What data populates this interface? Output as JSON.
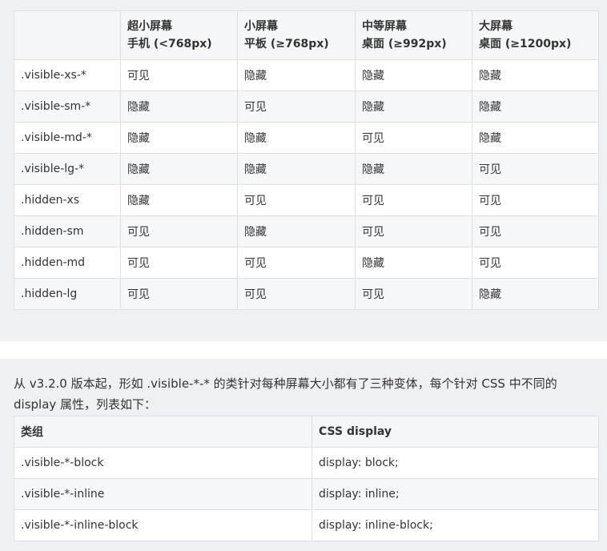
{
  "visibility_table": {
    "headers": [
      {
        "line1": "",
        "line2": ""
      },
      {
        "line1": "超小屏幕",
        "line2": "手机 (<768px)"
      },
      {
        "line1": "小屏幕",
        "line2": "平板 (≥768px)"
      },
      {
        "line1": "中等屏幕",
        "line2": "桌面 (≥992px)"
      },
      {
        "line1": "大屏幕",
        "line2": "桌面 (≥1200px)"
      }
    ],
    "rows": [
      {
        "cls": ".visible-xs-*",
        "cells": [
          "可见",
          "隐藏",
          "隐藏",
          "隐藏"
        ]
      },
      {
        "cls": ".visible-sm-*",
        "cells": [
          "隐藏",
          "可见",
          "隐藏",
          "隐藏"
        ]
      },
      {
        "cls": ".visible-md-*",
        "cells": [
          "隐藏",
          "隐藏",
          "可见",
          "隐藏"
        ]
      },
      {
        "cls": ".visible-lg-*",
        "cells": [
          "隐藏",
          "隐藏",
          "隐藏",
          "可见"
        ]
      },
      {
        "cls": ".hidden-xs",
        "cells": [
          "隐藏",
          "可见",
          "可见",
          "可见"
        ]
      },
      {
        "cls": ".hidden-sm",
        "cells": [
          "可见",
          "隐藏",
          "可见",
          "可见"
        ]
      },
      {
        "cls": ".hidden-md",
        "cells": [
          "可见",
          "可见",
          "隐藏",
          "可见"
        ]
      },
      {
        "cls": ".hidden-lg",
        "cells": [
          "可见",
          "可见",
          "可见",
          "隐藏"
        ]
      }
    ]
  },
  "intro_text": "从 v3.2.0 版本起，形如 .visible-*-* 的类针对每种屏幕大小都有了三种变体，每个针对 CSS 中不同的 display 属性，列表如下：",
  "class_table": {
    "headers": [
      "类组",
      "CSS display"
    ],
    "rows": [
      [
        ".visible-*-block",
        "display: block;"
      ],
      [
        ".visible-*-inline",
        "display: inline;"
      ],
      [
        ".visible-*-inline-block",
        "display: inline-block;"
      ]
    ]
  }
}
